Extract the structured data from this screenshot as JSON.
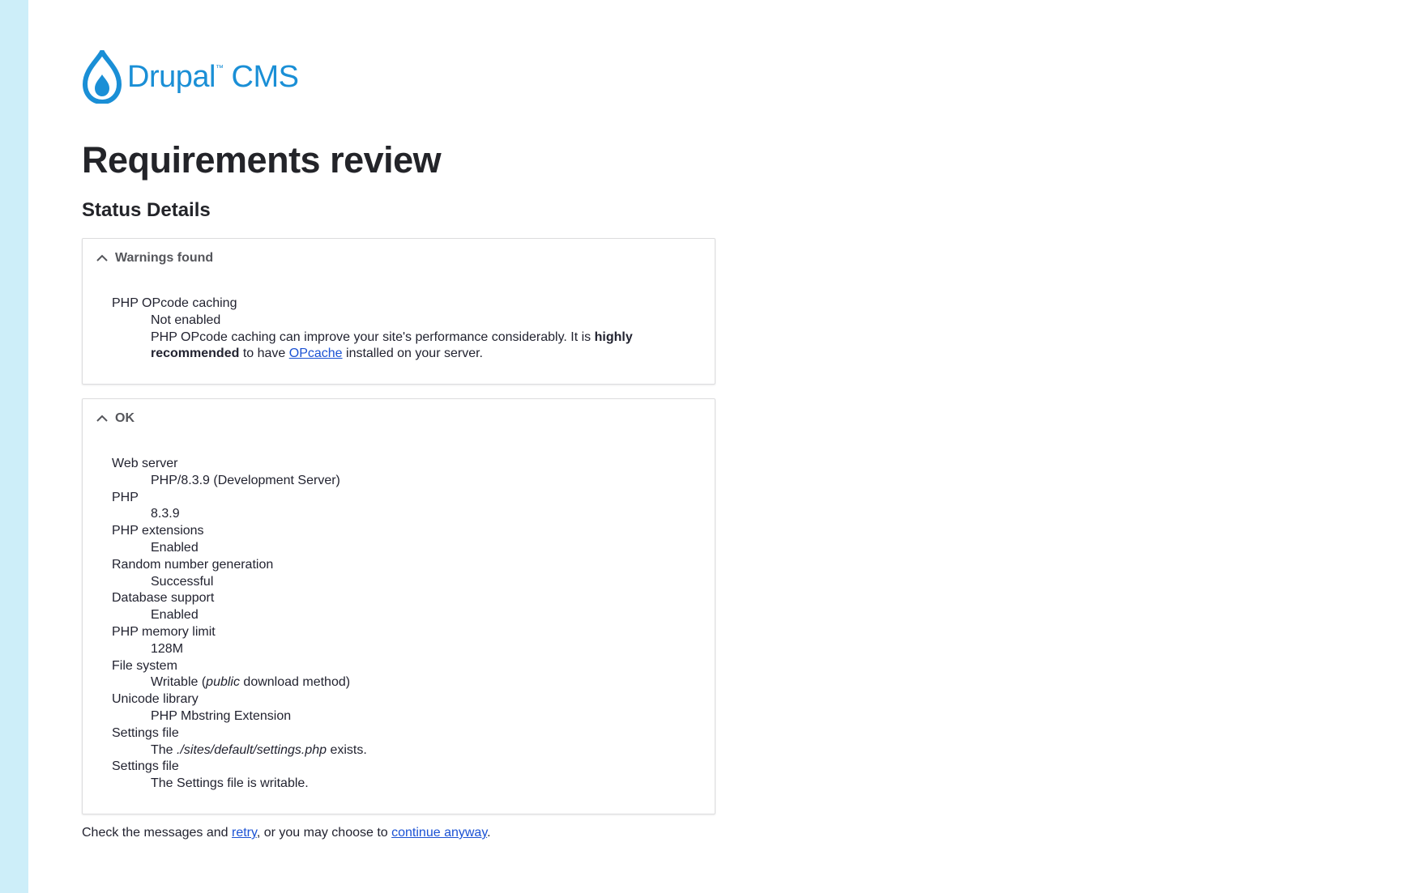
{
  "brand": {
    "name": "Drupal",
    "tm": "™",
    "product": "CMS",
    "color": "#1a8fd6"
  },
  "page_title": "Requirements review",
  "section_title": "Status Details",
  "warnings": {
    "heading": "Warnings found",
    "item_title": "PHP OPcode caching",
    "item_value": "Not enabled",
    "desc_pre": "PHP OPcode caching can improve your site's performance considerably. It is ",
    "desc_bold": "highly recommended",
    "desc_mid": " to have ",
    "desc_link": "OPcache",
    "desc_post": " installed on your server."
  },
  "ok": {
    "heading": "OK",
    "items": [
      {
        "title": "Web server",
        "value": "PHP/8.3.9 (Development Server)"
      },
      {
        "title": "PHP",
        "value": "8.3.9"
      },
      {
        "title": "PHP extensions",
        "value": "Enabled"
      },
      {
        "title": "Random number generation",
        "value": "Successful"
      },
      {
        "title": "Database support",
        "value": "Enabled"
      },
      {
        "title": "PHP memory limit",
        "value": "128M"
      },
      {
        "title": "File system",
        "value_pre": "Writable (",
        "value_em": "public",
        "value_post": " download method)"
      },
      {
        "title": "Unicode library",
        "value": "PHP Mbstring Extension"
      },
      {
        "title": "Settings file",
        "value_pre": "The ",
        "value_em": "./sites/default/settings.php",
        "value_post": " exists."
      },
      {
        "title": "Settings file",
        "value": "The Settings file is writable."
      }
    ]
  },
  "footer": {
    "pre": "Check the messages and ",
    "retry": "retry",
    "mid": ", or you may choose to ",
    "continue": "continue anyway",
    "post": "."
  },
  "colors": {
    "stripe": "#cdeef9",
    "link": "#1b52d4",
    "heading": "#232429"
  }
}
